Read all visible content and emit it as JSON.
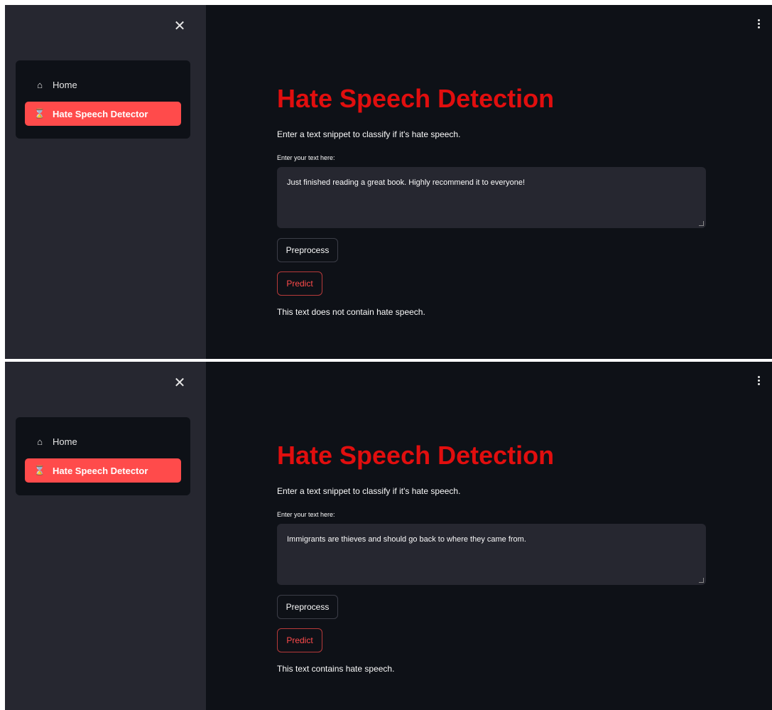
{
  "panels": [
    {
      "sidebar": {
        "close_glyph": "✕",
        "items": [
          {
            "label": "Home",
            "icon": "home-icon",
            "icon_glyph": "⌂"
          },
          {
            "label": "Hate Speech Detector",
            "icon": "hourglass-icon",
            "icon_glyph": "⌛"
          }
        ]
      },
      "main": {
        "title": "Hate Speech Detection",
        "subtitle": "Enter a text snippet to classify if it's hate speech.",
        "input_label": "Enter your text here:",
        "input_value": "Just finished reading a great book. Highly recommend it to everyone!",
        "preprocess_label": "Preprocess",
        "predict_label": "Predict",
        "result": "This text does not contain hate speech."
      }
    },
    {
      "sidebar": {
        "close_glyph": "✕",
        "items": [
          {
            "label": "Home",
            "icon": "home-icon",
            "icon_glyph": "⌂"
          },
          {
            "label": "Hate Speech Detector",
            "icon": "hourglass-icon",
            "icon_glyph": "⌛"
          }
        ]
      },
      "main": {
        "title": "Hate Speech Detection",
        "subtitle": "Enter a text snippet to classify if it's hate speech.",
        "input_label": "Enter your text here:",
        "input_value": "Immigrants are thieves and should go back to where they came from.",
        "preprocess_label": "Preprocess",
        "predict_label": "Predict",
        "result": "This text contains hate speech."
      }
    }
  ],
  "colors": {
    "app_background": "#0e1117",
    "sidebar_background": "#262730",
    "accent": "#ff4b4b",
    "title": "#e10e0e"
  }
}
